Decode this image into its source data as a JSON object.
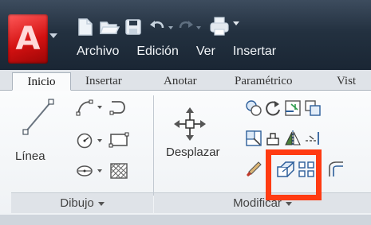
{
  "app": {
    "logo_letter": "A"
  },
  "menubar": [
    "Archivo",
    "Edición",
    "Ver",
    "Insertar"
  ],
  "tabs": [
    "Inicio",
    "Insertar",
    "Anotar",
    "Paramétrico",
    "Vist"
  ],
  "active_tab": "Inicio",
  "panels": {
    "dibujo": {
      "title": "Dibujo",
      "large_tool_label": "Línea",
      "tools": [
        "polyline-icon",
        "circle-icon",
        "ellipse-icon",
        "arc-icon",
        "rectangle-icon",
        "hatch-icon"
      ]
    },
    "modificar": {
      "title": "Modificar",
      "large_tool_label": "Desplazar",
      "tools": [
        "copy-icon",
        "rotate-icon",
        "trim-icon",
        "fillet-icon",
        "stretch-icon",
        "mirror-icon",
        "extend-icon",
        "erase-icon",
        "array-icon",
        "offset-icon",
        "scale-icon",
        "explode-icon"
      ]
    }
  },
  "highlight_color": "#ff3b12"
}
